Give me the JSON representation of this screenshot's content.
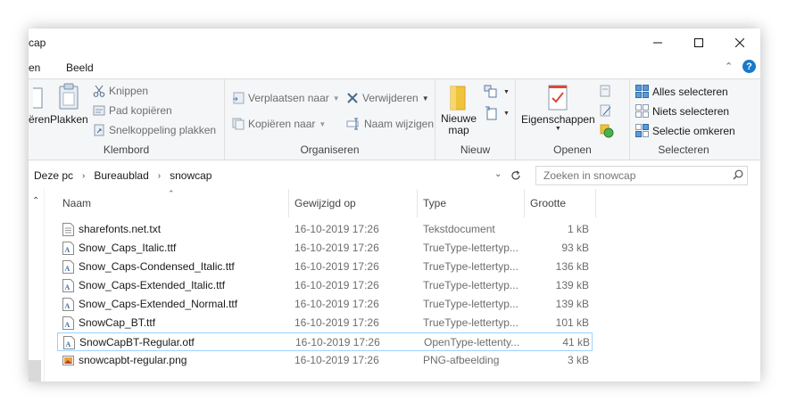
{
  "window": {
    "title": "cap"
  },
  "tabs": [
    {
      "label": "en"
    },
    {
      "label": "Beeld"
    }
  ],
  "ribbon": {
    "klembord": {
      "label": "Klembord",
      "kopieren": "ëren",
      "plakken": "Plakken",
      "knippen": "Knippen",
      "pad_kopieren": "Pad kopiëren",
      "snelkoppeling_plakken": "Snelkoppeling plakken"
    },
    "organiseren": {
      "label": "Organiseren",
      "verplaatsen": "Verplaatsen naar",
      "kopieren_naar": "Kopiëren naar",
      "verwijderen": "Verwijderen",
      "naam_wijzigen": "Naam wijzigen"
    },
    "nieuw": {
      "label": "Nieuw",
      "nieuwe_map_line1": "Nieuwe",
      "nieuwe_map_line2": "map"
    },
    "openen": {
      "label": "Openen",
      "eigenschappen": "Eigenschappen"
    },
    "selecteren": {
      "label": "Selecteren",
      "alles": "Alles selecteren",
      "niets": "Niets selecteren",
      "omkeren": "Selectie omkeren"
    }
  },
  "address": {
    "crumbs": [
      "Deze pc",
      "Bureaublad",
      "snowcap"
    ]
  },
  "search": {
    "placeholder": "Zoeken in snowcap"
  },
  "columns": {
    "name": "Naam",
    "date": "Gewijzigd op",
    "type": "Type",
    "size": "Grootte"
  },
  "files": [
    {
      "name": "sharefonts.net.txt",
      "date": "16-10-2019 17:26",
      "type": "Tekstdocument",
      "size": "1 kB",
      "icon": "text-file-icon"
    },
    {
      "name": "Snow_Caps_Italic.ttf",
      "date": "16-10-2019 17:26",
      "type": "TrueType-lettertyp...",
      "size": "93 kB",
      "icon": "font-file-icon"
    },
    {
      "name": "Snow_Caps-Condensed_Italic.ttf",
      "date": "16-10-2019 17:26",
      "type": "TrueType-lettertyp...",
      "size": "136 kB",
      "icon": "font-file-icon"
    },
    {
      "name": "Snow_Caps-Extended_Italic.ttf",
      "date": "16-10-2019 17:26",
      "type": "TrueType-lettertyp...",
      "size": "139 kB",
      "icon": "font-file-icon"
    },
    {
      "name": "Snow_Caps-Extended_Normal.ttf",
      "date": "16-10-2019 17:26",
      "type": "TrueType-lettertyp...",
      "size": "139 kB",
      "icon": "font-file-icon"
    },
    {
      "name": "SnowCap_BT.ttf",
      "date": "16-10-2019 17:26",
      "type": "TrueType-lettertyp...",
      "size": "101 kB",
      "icon": "font-file-icon"
    },
    {
      "name": "SnowCapBT-Regular.otf",
      "date": "16-10-2019 17:26",
      "type": "OpenType-lettenty...",
      "size": "41 kB",
      "icon": "font-file-icon",
      "selected": true
    },
    {
      "name": "snowcapbt-regular.png",
      "date": "16-10-2019 17:26",
      "type": "PNG-afbeelding",
      "size": "3 kB",
      "icon": "image-file-icon"
    }
  ],
  "colors": {
    "accent": "#1979ca",
    "selection_border": "#99d1ff",
    "folder": "#f0c33c"
  }
}
